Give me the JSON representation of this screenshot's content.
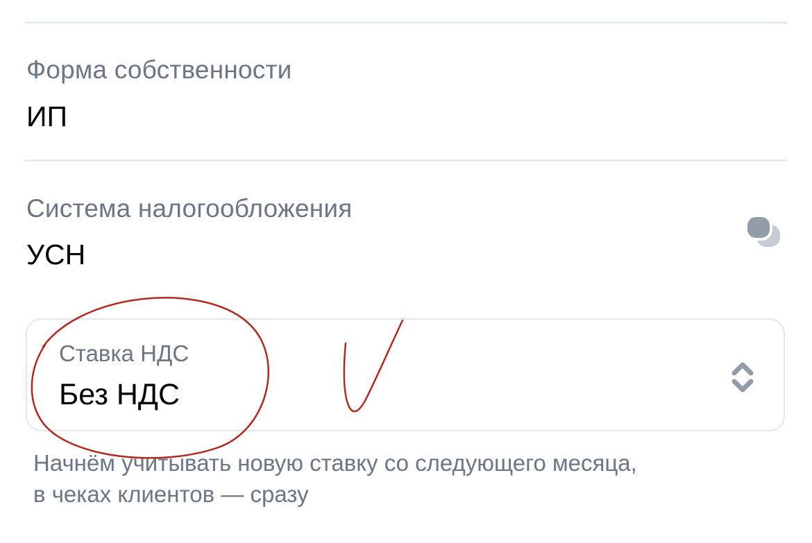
{
  "ownership": {
    "label": "Форма собственности",
    "value": "ИП"
  },
  "tax_system": {
    "label": "Система налогообложения",
    "value": "УСН",
    "action_icon": "chat-bubbles-icon"
  },
  "vat_rate": {
    "label": "Ставка НДС",
    "value": "Без НДС",
    "icon": "chevron-up-down-icon"
  },
  "hint": {
    "line1": "Начнём учитывать новую ставку со следующего месяца,",
    "line2": "в чеках клиентов — сразу"
  },
  "colors": {
    "label_gray": "#6c7785",
    "divider": "#e6ebf1",
    "icon_gray": "#939daa",
    "annotation_red": "#b5281f"
  }
}
